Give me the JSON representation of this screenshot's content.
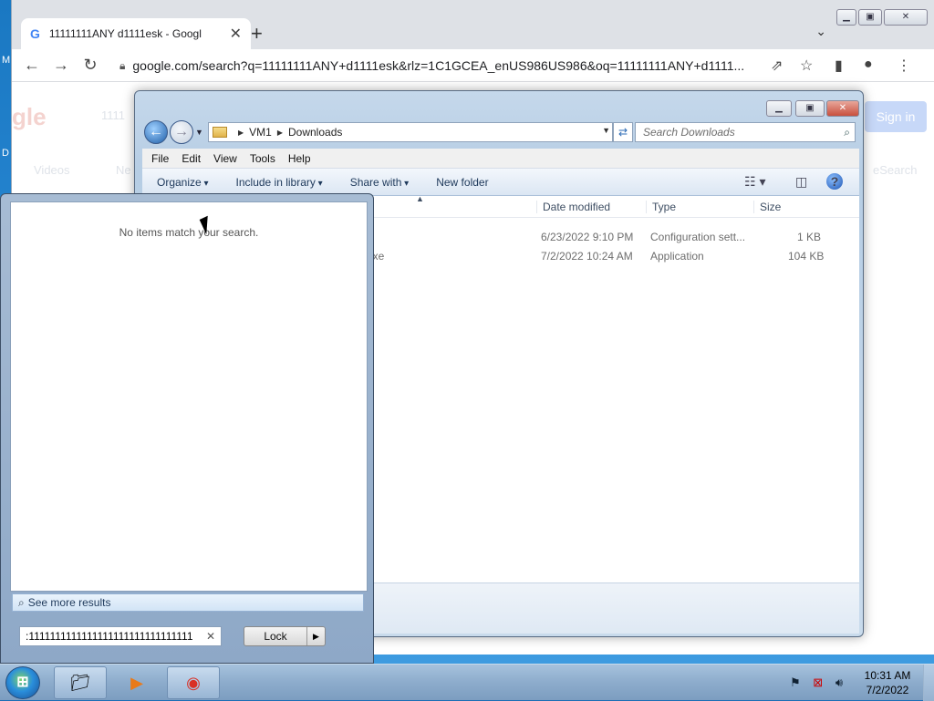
{
  "desktop": {
    "left_text_1": "M",
    "left_text_2": "D"
  },
  "chrome": {
    "tab_title": "11111111ANY d1111esk - Googl",
    "tab_close": "✕",
    "new_tab": "+",
    "url": "google.com/search?q=11111111ANY+d1111esk&rlz=1C1GCEA_enUS986US986&oq=11111111ANY+d1111...",
    "page_ghost": {
      "logo": "gle",
      "query": "1111",
      "tab_videos": "Videos",
      "tab_ne": "Ne",
      "sign_in": "Sign in",
      "right_text": "eSearch"
    }
  },
  "explorer": {
    "breadcrumb": [
      "VM1",
      "Downloads"
    ],
    "search_placeholder": "Search Downloads",
    "menu": [
      "File",
      "Edit",
      "View",
      "Tools",
      "Help"
    ],
    "commands": {
      "organize": "Organize",
      "include": "Include in library",
      "share": "Share with",
      "new_folder": "New folder"
    },
    "columns": {
      "date": "Date modified",
      "type": "Type",
      "size": "Size"
    },
    "rows": [
      {
        "name": "",
        "date": "6/23/2022 9:10 PM",
        "type": "Configuration sett...",
        "size": "1 KB"
      },
      {
        "name": "exe",
        "date": "7/2/2022 10:24 AM",
        "type": "Application",
        "size": "104 KB"
      }
    ]
  },
  "search_panel": {
    "empty_message": "No items match your search.",
    "see_more": "See more results",
    "query": ":1111111111111111111111111111111",
    "lock_label": "Lock"
  },
  "taskbar": {
    "time": "10:31 AM",
    "date": "7/2/2022"
  }
}
